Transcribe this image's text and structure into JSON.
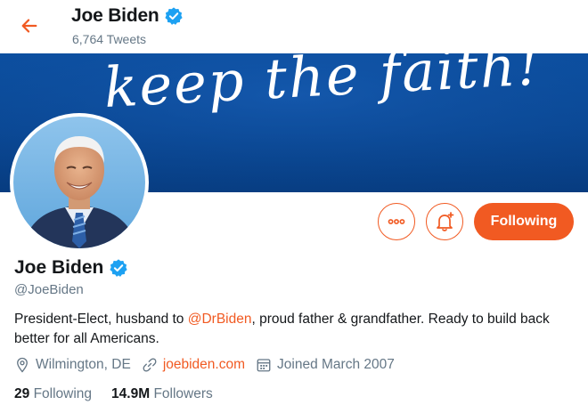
{
  "header": {
    "name": "Joe Biden",
    "tweet_count": "6,764 Tweets"
  },
  "banner": {
    "text": "keep the faith!"
  },
  "actions": {
    "following_label": "Following"
  },
  "profile": {
    "name": "Joe Biden",
    "handle": "@JoeBiden",
    "bio_before": "President-Elect, husband to ",
    "bio_mention": "@DrBiden",
    "bio_after": ", proud father & grandfather. Ready to build back better for all Americans.",
    "location": "Wilmington, DE",
    "website": "joebiden.com",
    "joined": "Joined March 2007"
  },
  "stats": {
    "following_count": "29",
    "following_label": "Following",
    "followers_count": "14.9M",
    "followers_label": "Followers"
  },
  "colors": {
    "accent": "#f15a22",
    "verified": "#1da1f2",
    "banner": "#0a4793",
    "muted": "#657786"
  },
  "icons": [
    "back-arrow-icon",
    "verified-badge-icon",
    "more-options-icon",
    "notification-bell-icon",
    "location-pin-icon",
    "link-icon",
    "calendar-icon"
  ]
}
